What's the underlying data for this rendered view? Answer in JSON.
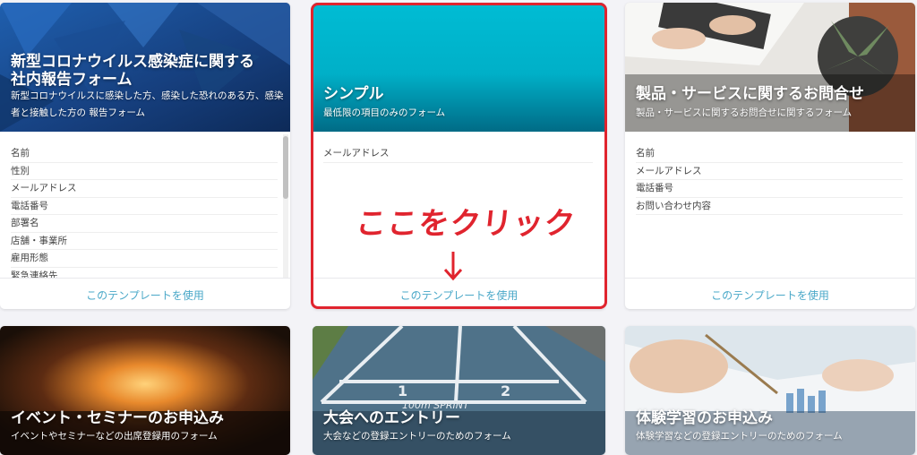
{
  "cards": [
    {
      "title_lines": [
        "新型コロナウイルス感染症に関する",
        "社内報告フォーム"
      ],
      "desc_lines": [
        "新型コロナウイルスに感染した方、感染した恐れのある方、感染",
        "者と接触した方の 報告フォーム"
      ],
      "fields": [
        "名前",
        "性別",
        "メールアドレス",
        "電話番号",
        "部署名",
        "店舗・事業所",
        "雇用形態",
        "緊急連絡先"
      ],
      "button": "このテンプレートを使用"
    },
    {
      "title": "シンプル",
      "desc": "最低限の項目のみのフォーム",
      "fields": [
        "メールアドレス"
      ],
      "button": "このテンプレートを使用"
    },
    {
      "title": "製品・サービスに関するお問合せ",
      "desc": "製品・サービスに関するお問合せに関するフォーム",
      "fields": [
        "名前",
        "メールアドレス",
        "電話番号",
        "お問い合わせ内容"
      ],
      "button": "このテンプレートを使用"
    },
    {
      "title": "イベント・セミナーのお申込み",
      "desc": "イベントやセミナーなどの出席登録用のフォーム"
    },
    {
      "title": "大会へのエントリー",
      "desc": "大会などの登録エントリーのためのフォーム",
      "track_text": [
        "1",
        "2",
        "100m SPRINT"
      ]
    },
    {
      "title": "体験学習のお申込み",
      "desc": "体験学習などの登録エントリーのためのフォーム"
    }
  ],
  "annotation": {
    "text": "ここをクリック",
    "arrow": "↓",
    "color": "#e0242e"
  },
  "colors": {
    "accent_link": "#4aa8c8",
    "simple_header": "#00b8d0"
  }
}
